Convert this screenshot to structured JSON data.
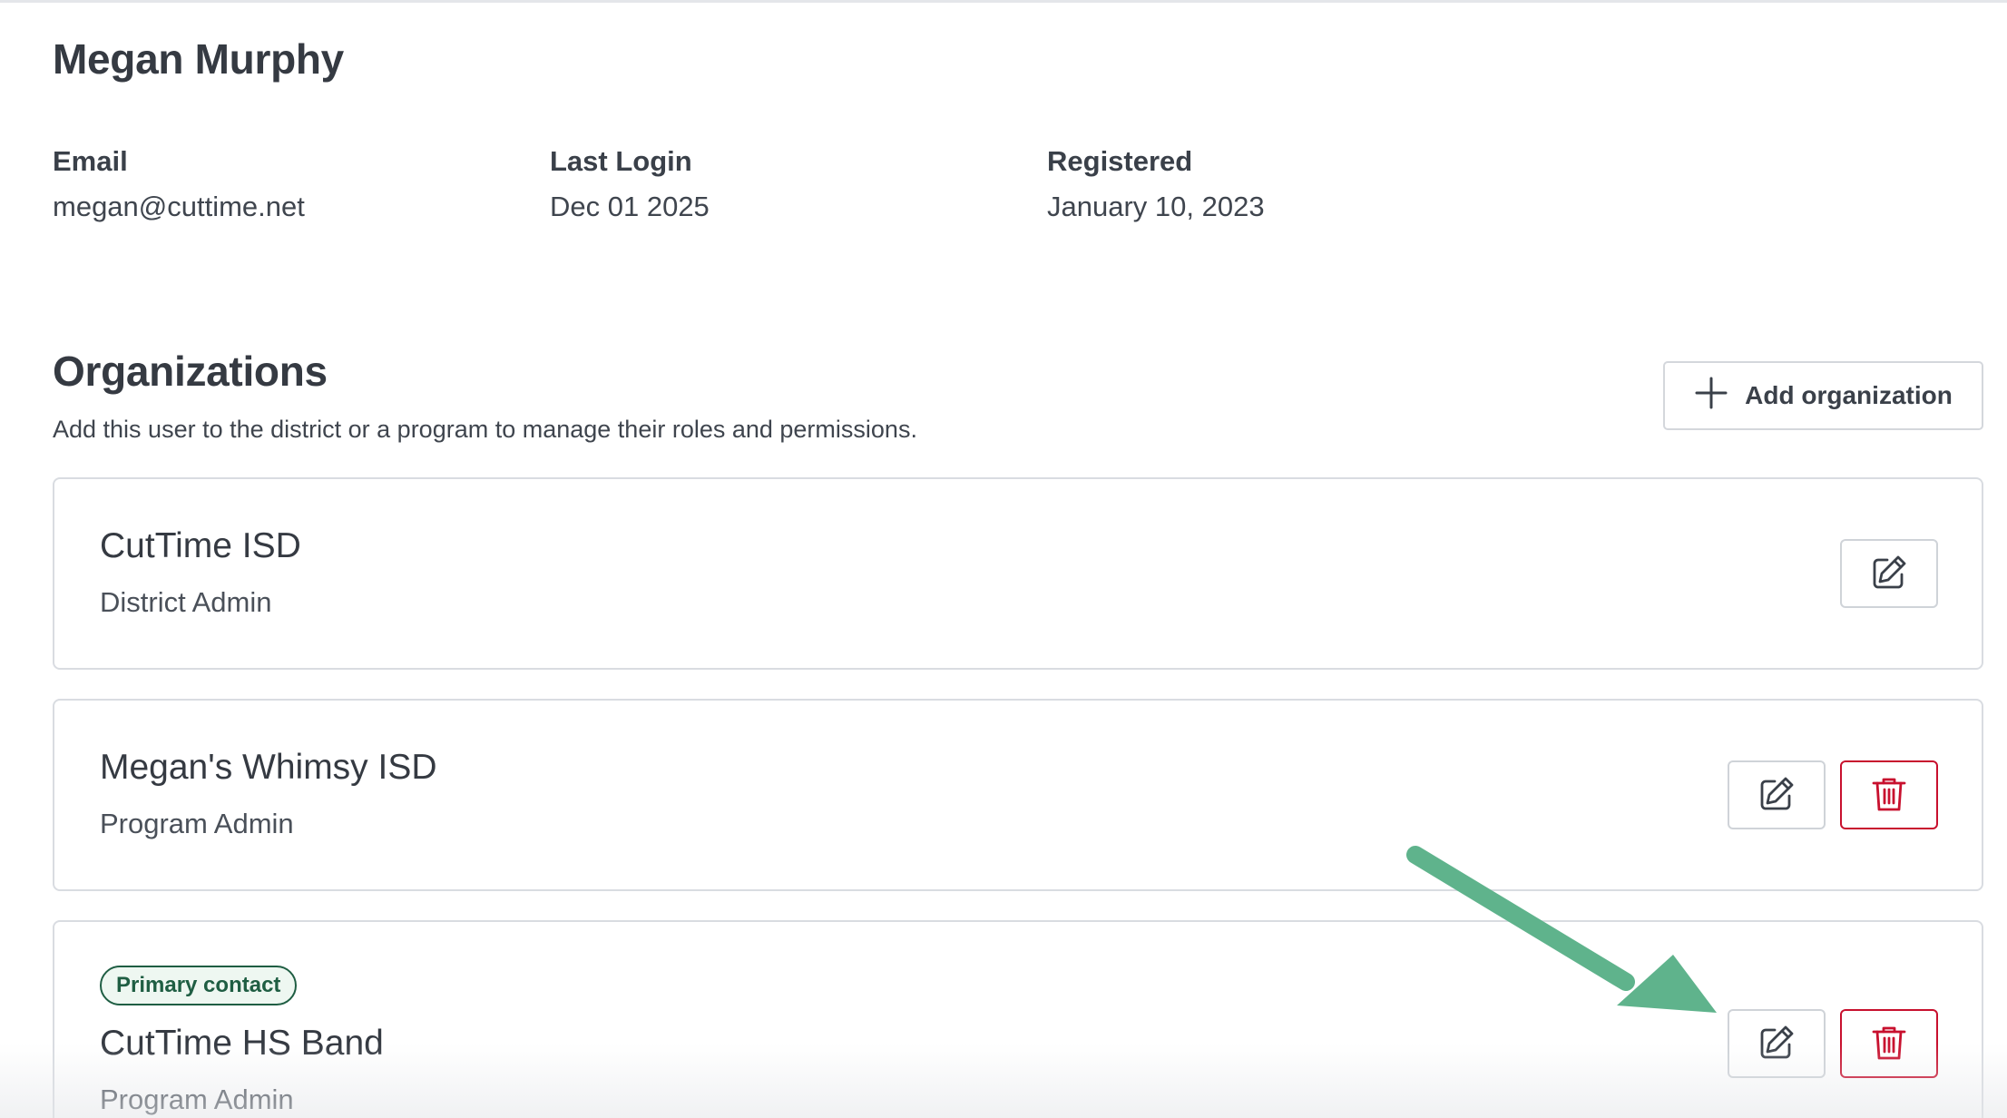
{
  "user": {
    "name": "Megan Murphy",
    "email_label": "Email",
    "email": "megan@cuttime.net",
    "last_login_label": "Last Login",
    "last_login": "Dec 01 2025",
    "registered_label": "Registered",
    "registered": "January 10, 2023"
  },
  "organizations": {
    "title": "Organizations",
    "subtitle": "Add this user to the district or a program to manage their roles and permissions.",
    "add_label": "Add organization",
    "items": [
      {
        "name": "CutTime ISD",
        "role": "District Admin"
      },
      {
        "name": "Megan's Whimsy ISD",
        "role": "Program Admin"
      },
      {
        "name": "CutTime HS Band",
        "role": "Program Admin",
        "badge": "Primary contact"
      }
    ]
  },
  "icons": {
    "add": "plus-icon",
    "edit": "edit-square-pen-icon",
    "delete": "trash-icon",
    "annotation": "green-arrow-icon"
  },
  "colors": {
    "text": "#3a4049",
    "border": "#d9dce1",
    "danger": "#c8102e",
    "badge_green": "#1f5e43",
    "annotation_arrow": "#5fb38c"
  }
}
